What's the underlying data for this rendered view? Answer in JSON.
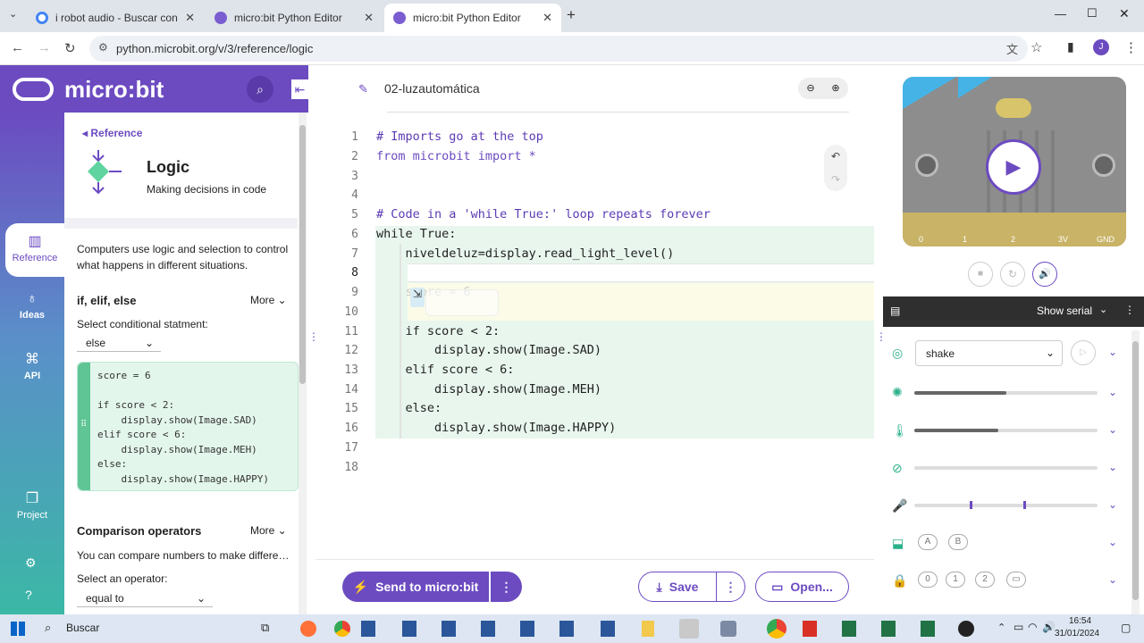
{
  "browser": {
    "tabs": [
      {
        "title": "i robot audio - Buscar con Goo"
      },
      {
        "title": "micro:bit Python Editor"
      },
      {
        "title": "micro:bit Python Editor"
      }
    ],
    "url": "python.microbit.org/v/3/reference/logic",
    "profile_initial": "J"
  },
  "brand": {
    "name": "micro:bit"
  },
  "sidenav": {
    "reference": "Reference",
    "ideas": "Ideas",
    "api": "API",
    "project": "Project"
  },
  "reference": {
    "back_label": "Reference",
    "title": "Logic",
    "subtitle": "Making decisions in code",
    "intro": "Computers use logic and selection to control what happens in different situations.",
    "section1": {
      "title": "if, elif, else",
      "more": "More",
      "select_label": "Select conditional statment:",
      "select_value": "else",
      "code": "score = 6\n\nif score < 2:\n    display.show(Image.SAD)\nelif score < 6:\n    display.show(Image.MEH)\nelse:\n    display.show(Image.HAPPY)"
    },
    "section2": {
      "title": "Comparison operators",
      "more": "More",
      "desc": "You can compare numbers to make differe…",
      "select_label": "Select an operator:",
      "select_value": "equal to"
    }
  },
  "editor": {
    "project_name": "02-luzautomática",
    "lines": [
      {
        "n": "1",
        "text": "# Imports go at the top"
      },
      {
        "n": "2",
        "text": "from microbit import *"
      },
      {
        "n": "3",
        "text": ""
      },
      {
        "n": "4",
        "text": ""
      },
      {
        "n": "5",
        "text": "# Code in a 'while True:' loop repeats forever"
      },
      {
        "n": "6",
        "text": "while True:"
      },
      {
        "n": "7",
        "text": "    niveldeluz=display.read_light_level()"
      },
      {
        "n": "8",
        "text": ""
      },
      {
        "n": "9",
        "text": "    score = 6"
      },
      {
        "n": "10",
        "text": ""
      },
      {
        "n": "11",
        "text": "    if score < 2:"
      },
      {
        "n": "12",
        "text": "        display.show(Image.SAD)"
      },
      {
        "n": "13",
        "text": "    elif score < 6:"
      },
      {
        "n": "14",
        "text": "        display.show(Image.MEH)"
      },
      {
        "n": "15",
        "text": "    else:"
      },
      {
        "n": "16",
        "text": "        display.show(Image.HAPPY)"
      },
      {
        "n": "17",
        "text": ""
      },
      {
        "n": "18",
        "text": ""
      }
    ],
    "send_button": "Send to micro:bit",
    "save_button": "Save",
    "open_button": "Open..."
  },
  "simulator": {
    "pins": [
      "0",
      "1",
      "2",
      "3V",
      "GND"
    ],
    "serial_label": "Show serial",
    "gesture_value": "shake",
    "buttons": [
      "A",
      "B"
    ],
    "touch_pins": [
      "0",
      "1",
      "2"
    ],
    "sensors": {
      "light_level": 0.5,
      "temperature_level": 0.46
    }
  },
  "taskbar": {
    "search": "Buscar",
    "time": "16:54",
    "date": "31/01/2024"
  }
}
